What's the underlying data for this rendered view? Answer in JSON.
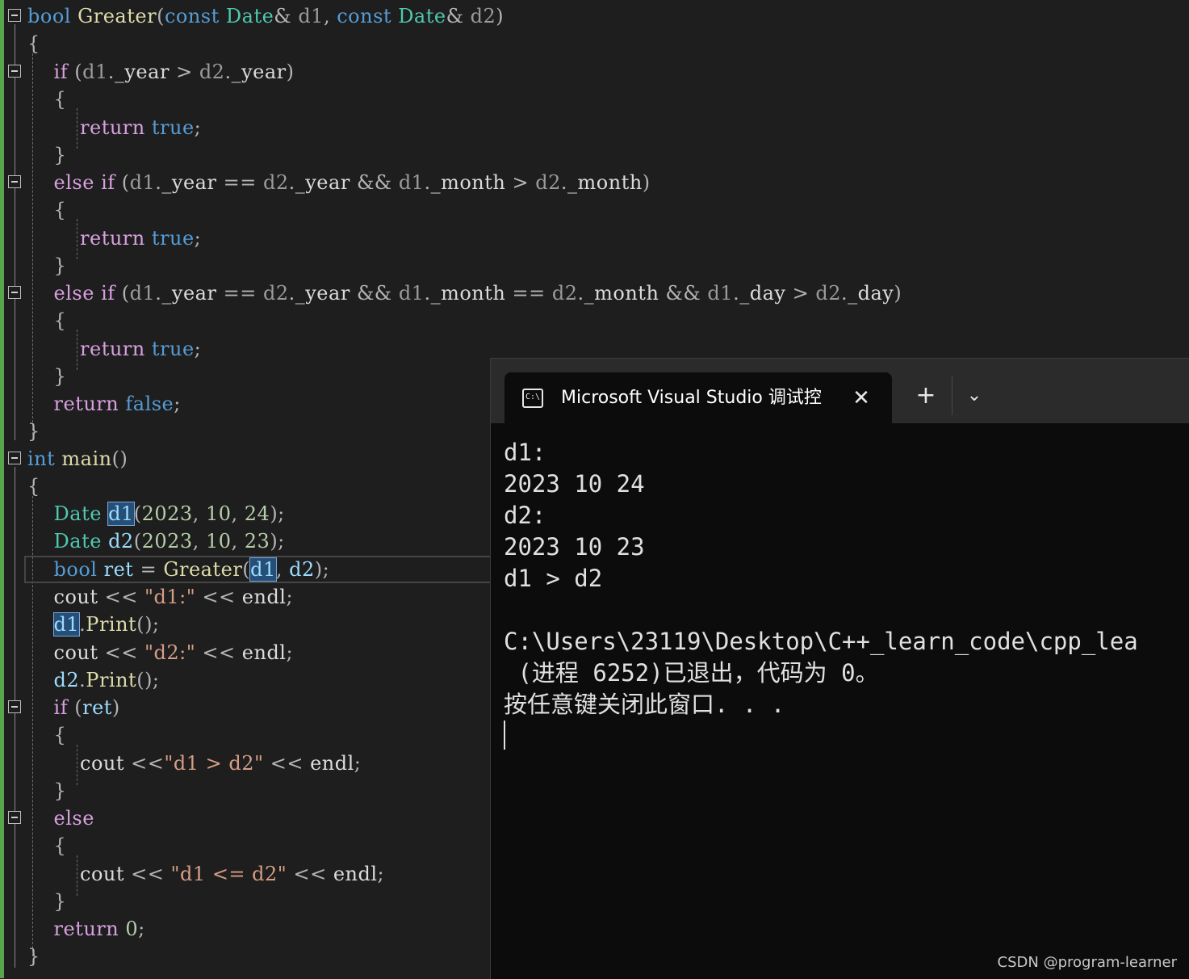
{
  "editor": {
    "lines": [
      "bool Greater(const Date& d1, const Date& d2)",
      "{",
      "    if (d1._year > d2._year)",
      "    {",
      "        return true;",
      "    }",
      "    else if (d1._year == d2._year && d1._month > d2._month)",
      "    {",
      "        return true;",
      "    }",
      "    else if (d1._year == d2._year && d1._month == d2._month && d1._day > d2._day)",
      "    {",
      "        return true;",
      "    }",
      "    return false;",
      "}",
      "int main()",
      "{",
      "    Date d1(2023, 10, 24);",
      "    Date d2(2023, 10, 23);",
      "    bool ret = Greater(d1, d2);",
      "    cout << \"d1:\" << endl;",
      "    d1.Print();",
      "    cout << \"d2:\" << endl;",
      "    d2.Print();",
      "    if (ret)",
      "    {",
      "        cout <<\"d1 > d2\" << endl;",
      "    }",
      "    else",
      "    {",
      "        cout << \"d1 <= d2\" << endl;",
      "    }",
      "    return 0;",
      "}"
    ],
    "highlighted_identifier": "d1",
    "colors": {
      "background": "#1e1e1e",
      "keyword": "#569cd6",
      "control": "#d8a0df",
      "type": "#4ec9b0",
      "function": "#dcdcaa",
      "variable": "#9cdcfe",
      "parameter": "#9a9a9a",
      "string": "#d69d85",
      "number": "#b5cea8",
      "selection": "#264f78"
    },
    "icons": {
      "collapse": "minus-box-icon"
    }
  },
  "console": {
    "tab_title": "Microsoft Visual Studio 调试控",
    "tab_icon_text": "C:\\",
    "close_glyph": "✕",
    "new_tab_glyph": "+",
    "dropdown_glyph": "⌄",
    "output": [
      "d1:",
      "2023 10 24",
      "d2:",
      "2023 10 23",
      "d1 > d2",
      "",
      "C:\\Users\\23119\\Desktop\\C++_learn_code\\cpp_lea",
      " (进程 6252)已退出，代码为 0。",
      "按任意键关闭此窗口. . ."
    ],
    "colors": {
      "background": "#0c0c0c",
      "tabstrip": "#2b2b2b",
      "text": "#e0e0e0"
    }
  },
  "watermark": "CSDN @program-learner"
}
